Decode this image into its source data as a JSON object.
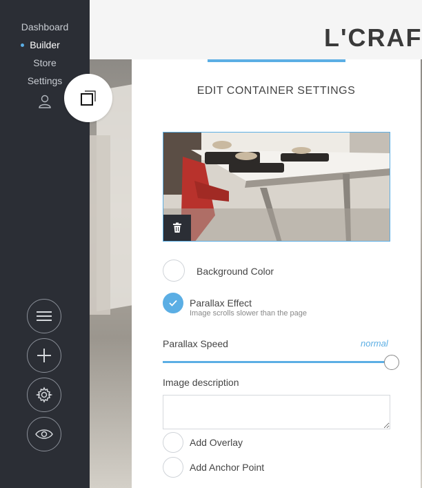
{
  "sidebar": {
    "items": [
      {
        "label": "Dashboard",
        "active": false
      },
      {
        "label": "Builder",
        "active": true
      },
      {
        "label": "Store",
        "active": false
      },
      {
        "label": "Settings",
        "active": false
      }
    ],
    "icons": [
      "user-icon",
      "menu-icon",
      "plus-icon",
      "gear-icon",
      "eye-icon"
    ]
  },
  "site": {
    "title": "L'CRAFT"
  },
  "panel": {
    "title": "EDIT CONTAINER SETTINGS",
    "background_color_label": "Background Color",
    "parallax_label": "Parallax Effect",
    "parallax_sublabel": "Image scrolls slower than the page",
    "parallax_checked": true,
    "parallax_speed_label": "Parallax Speed",
    "parallax_speed_value": "normal",
    "parallax_speed_level": 1.0,
    "image_description_label": "Image description",
    "image_description_value": "",
    "add_overlay_label": "Add Overlay",
    "add_anchor_label": "Add Anchor Point"
  },
  "colors": {
    "sidebar_bg": "#2b2e35",
    "accent": "#5baee4",
    "panel_bg": "#ffffff"
  }
}
